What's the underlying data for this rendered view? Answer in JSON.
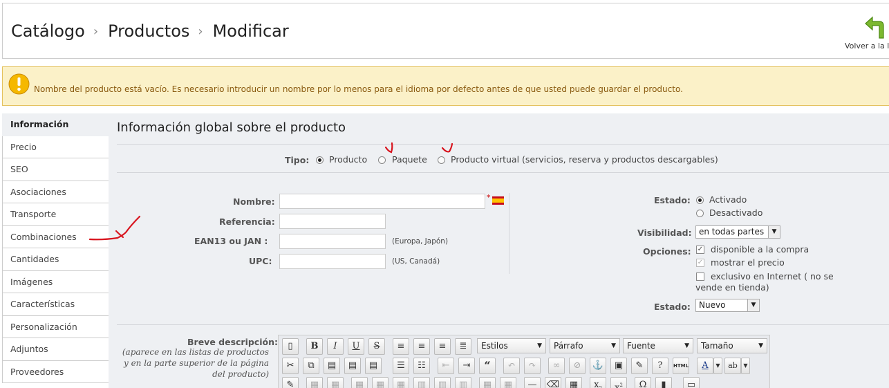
{
  "breadcrumb": {
    "items": [
      "Catálogo",
      "Productos",
      "Modificar"
    ],
    "separator": "›"
  },
  "header": {
    "back_label": "Volver a la li"
  },
  "warning": {
    "text": "Nombre del producto está vacío. Es necesario introducir un nombre por lo menos para el idioma por defecto antes de que usted puede guardar el producto."
  },
  "sidebar": {
    "items": [
      {
        "label": "Información",
        "active": true
      },
      {
        "label": "Precio"
      },
      {
        "label": "SEO"
      },
      {
        "label": "Asociaciones"
      },
      {
        "label": "Transporte"
      },
      {
        "label": "Combinaciones"
      },
      {
        "label": "Cantidades"
      },
      {
        "label": "Imágenes"
      },
      {
        "label": "Características"
      },
      {
        "label": "Personalización"
      },
      {
        "label": "Adjuntos"
      },
      {
        "label": "Proveedores"
      }
    ]
  },
  "main": {
    "title": "Información global sobre el producto",
    "tipo": {
      "label": "Tipo:",
      "options": [
        "Producto",
        "Paquete",
        "Producto virtual (servicios, reserva y productos descargables)"
      ],
      "selected": "Producto"
    },
    "fields": {
      "nombre": {
        "label": "Nombre:",
        "value": "",
        "required_mark": "*"
      },
      "referencia": {
        "label": "Referencia:",
        "value": ""
      },
      "ean13": {
        "label": "EAN13 ou JAN :",
        "value": "",
        "hint": "(Europa, Japón)"
      },
      "upc": {
        "label": "UPC:",
        "value": "",
        "hint": "(US, Canadá)"
      }
    },
    "estado": {
      "label": "Estado:",
      "options": [
        "Activado",
        "Desactivado"
      ],
      "selected": "Activado"
    },
    "visibilidad": {
      "label": "Visibilidad:",
      "value": "en todas partes"
    },
    "opciones": {
      "label": "Opciones:",
      "items": [
        {
          "label": "disponible a la compra",
          "checked": true
        },
        {
          "label": "mostrar el precio",
          "checked": true,
          "disabled": true
        },
        {
          "label": "exclusivo en Internet ( no se",
          "label2": "vende en tienda)",
          "checked": false
        }
      ]
    },
    "condicion": {
      "label": "Estado:",
      "value": "Nuevo"
    },
    "breve": {
      "label": "Breve descripción:",
      "hint": [
        "(aparece en las listas de productos",
        "y en la parte superior de la página",
        "del producto)"
      ]
    }
  },
  "editor": {
    "formats": {
      "bold": "B",
      "italic": "I",
      "underline": "U",
      "strike": "S"
    },
    "quote": "“",
    "styles": "Estilos",
    "paragraph": "Párrafo",
    "font": "Fuente",
    "size": "Tamaño",
    "sub": "x",
    "sup": "x",
    "omega": "Ω",
    "html_btn": "HTML",
    "color_btn": "A",
    "spell_btn": "ab",
    "hr_btn": "—"
  },
  "colors": {
    "warning_bg": "#fbf1c8",
    "warning_text": "#8a5a10",
    "panel_bg": "#eef0f3",
    "annotation": "#d8141e"
  }
}
